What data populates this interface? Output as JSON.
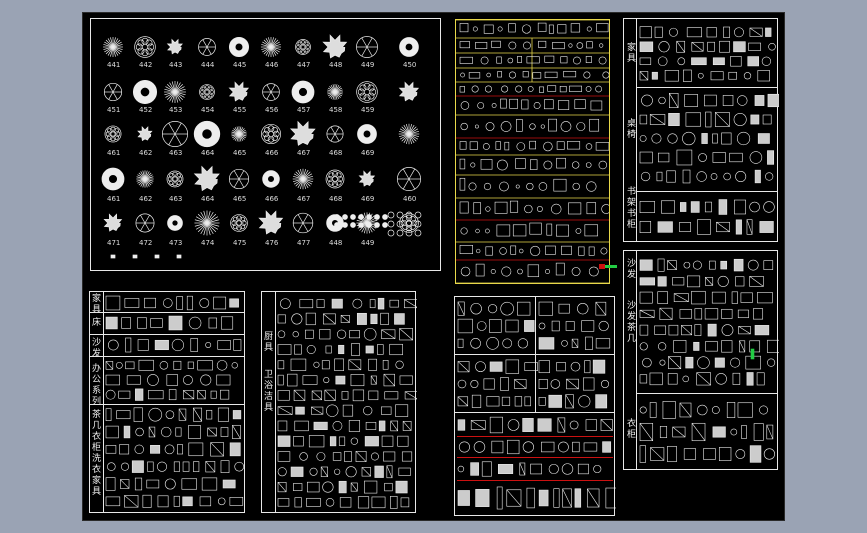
{
  "colors": {
    "background": "#9aa3b4",
    "drawing_area": "#000000",
    "line": "#e8e8e8",
    "yellow_grid": "#e8d84a",
    "red_divider": "#cc1111",
    "marker_green": "#22cc44"
  },
  "plants": {
    "row_captions": [
      [
        "441",
        "442",
        "443",
        "444",
        "445",
        "446",
        "447",
        "448",
        "449",
        "450"
      ],
      [
        "451",
        "452",
        "453",
        "454",
        "455",
        "456",
        "457",
        "458",
        "459"
      ],
      [
        "461",
        "462",
        "463",
        "464",
        "465",
        "466",
        "467",
        "468",
        "469"
      ],
      [
        "461",
        "462",
        "463",
        "464",
        "465",
        "466",
        "467",
        "468",
        "469",
        "460"
      ],
      [
        "471",
        "472",
        "473",
        "474",
        "475",
        "476",
        "477",
        "448",
        "449"
      ]
    ]
  },
  "left_bottom": {
    "labels": [
      "家具",
      "床",
      "沙发",
      "办公系列",
      "茶几",
      "衣柜",
      "洗衣",
      "家具"
    ]
  },
  "middle_bottom": {
    "labels": [
      "厨具",
      "卫浴",
      "洁具"
    ]
  },
  "right_top": {
    "labels": [
      "家具",
      "桌椅",
      "书架书柜"
    ]
  },
  "right_bottom": {
    "labels": [
      "沙发",
      "沙发茶几",
      "衣柜"
    ]
  }
}
